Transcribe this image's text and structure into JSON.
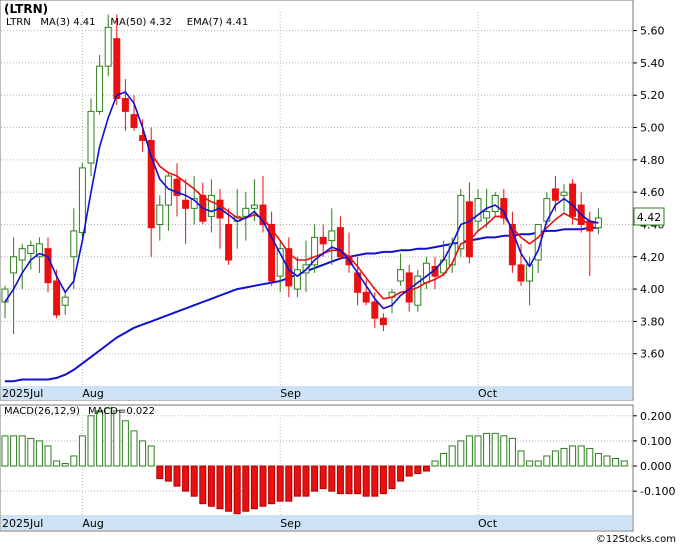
{
  "header": {
    "symbol": "(LTRN)",
    "legend": [
      {
        "name": "LTRN",
        "color": "#1f3bd6"
      },
      {
        "name": "MA(3)",
        "value": "4.41",
        "color": "#1f3bd6"
      },
      {
        "name": "MA(50)",
        "value": "4.32",
        "color": "#1f3bd6"
      },
      {
        "name": "EMA(7)",
        "value": "4.41",
        "color": "#1f3bd6"
      }
    ]
  },
  "last_price_label": "4.42",
  "macd": {
    "label": "MACD(26,12,9)",
    "value_label": "MACD=0.022"
  },
  "footer": {
    "brand": "©12Stocks.com"
  },
  "colors": {
    "up": "#2e7d1f",
    "down": "#e81010",
    "ma_blue": "#1010d0",
    "ema_red": "#e81010",
    "axis_band": "#cde3f5",
    "grid": "#b8b8b8"
  },
  "chart_data": [
    {
      "type": "candlestick",
      "title": "(LTRN)",
      "x_tick_labels": [
        "2025Jul",
        "Aug",
        "Sep",
        "Oct"
      ],
      "x_tick_index": [
        0,
        9,
        32,
        55
      ],
      "y_ticks": [
        3.6,
        3.8,
        4.0,
        4.2,
        4.4,
        4.6,
        4.8,
        5.0,
        5.2,
        5.4,
        5.6
      ],
      "ylim": [
        3.4,
        5.74
      ],
      "last_price": 4.42,
      "grid": true,
      "ohlc": [
        [
          3.92,
          4.02,
          3.82,
          4.0
        ],
        [
          4.1,
          4.32,
          3.72,
          4.2
        ],
        [
          4.18,
          4.28,
          4.0,
          4.25
        ],
        [
          4.22,
          4.3,
          4.12,
          4.27
        ],
        [
          4.2,
          4.32,
          4.1,
          4.28
        ],
        [
          4.25,
          4.32,
          3.98,
          4.04
        ],
        [
          4.05,
          4.12,
          3.82,
          3.84
        ],
        [
          3.9,
          3.98,
          3.84,
          3.95
        ],
        [
          4.2,
          4.5,
          4.0,
          4.36
        ],
        [
          4.35,
          4.78,
          4.32,
          4.75
        ],
        [
          4.78,
          5.18,
          4.7,
          5.1
        ],
        [
          5.1,
          5.45,
          5.08,
          5.38
        ],
        [
          5.38,
          5.7,
          5.32,
          5.62
        ],
        [
          5.55,
          5.7,
          5.14,
          5.18
        ],
        [
          5.18,
          5.3,
          4.98,
          5.1
        ],
        [
          5.08,
          5.2,
          4.98,
          5.0
        ],
        [
          4.95,
          5.05,
          4.85,
          4.92
        ],
        [
          4.92,
          5.0,
          4.2,
          4.38
        ],
        [
          4.4,
          4.58,
          4.3,
          4.52
        ],
        [
          4.52,
          4.72,
          4.36,
          4.7
        ],
        [
          4.68,
          4.78,
          4.45,
          4.58
        ],
        [
          4.55,
          4.68,
          4.28,
          4.5
        ],
        [
          4.5,
          4.7,
          4.4,
          4.56
        ],
        [
          4.58,
          4.66,
          4.4,
          4.42
        ],
        [
          4.45,
          4.68,
          4.35,
          4.58
        ],
        [
          4.55,
          4.62,
          4.25,
          4.44
        ],
        [
          4.4,
          4.5,
          4.15,
          4.18
        ],
        [
          4.42,
          4.62,
          4.25,
          4.45
        ],
        [
          4.45,
          4.6,
          4.3,
          4.5
        ],
        [
          4.5,
          4.68,
          4.42,
          4.52
        ],
        [
          4.52,
          4.7,
          4.35,
          4.4
        ],
        [
          4.4,
          4.48,
          4.02,
          4.05
        ],
        [
          4.08,
          4.3,
          3.98,
          4.25
        ],
        [
          4.25,
          4.32,
          3.95,
          4.02
        ],
        [
          4.0,
          4.2,
          3.95,
          4.12
        ],
        [
          4.1,
          4.3,
          3.98,
          4.15
        ],
        [
          4.15,
          4.4,
          4.1,
          4.32
        ],
        [
          4.32,
          4.4,
          4.2,
          4.28
        ],
        [
          4.3,
          4.5,
          4.15,
          4.36
        ],
        [
          4.38,
          4.45,
          4.18,
          4.2
        ],
        [
          4.2,
          4.35,
          4.1,
          4.15
        ],
        [
          4.1,
          4.2,
          3.9,
          3.98
        ],
        [
          3.98,
          4.06,
          3.9,
          3.92
        ],
        [
          3.92,
          3.98,
          3.76,
          3.82
        ],
        [
          3.82,
          3.85,
          3.74,
          3.78
        ],
        [
          3.95,
          4.0,
          3.85,
          3.98
        ],
        [
          4.05,
          4.22,
          4.02,
          4.12
        ],
        [
          4.1,
          4.15,
          3.86,
          3.92
        ],
        [
          3.9,
          4.12,
          3.86,
          4.08
        ],
        [
          4.04,
          4.2,
          4.0,
          4.16
        ],
        [
          4.14,
          4.2,
          4.0,
          4.08
        ],
        [
          4.1,
          4.3,
          4.08,
          4.18
        ],
        [
          4.15,
          4.32,
          4.1,
          4.28
        ],
        [
          4.25,
          4.62,
          4.2,
          4.58
        ],
        [
          4.54,
          4.66,
          4.16,
          4.2
        ],
        [
          4.42,
          4.62,
          4.35,
          4.56
        ],
        [
          4.44,
          4.62,
          4.38,
          4.48
        ],
        [
          4.48,
          4.6,
          4.45,
          4.58
        ],
        [
          4.56,
          4.62,
          4.4,
          4.44
        ],
        [
          4.4,
          4.48,
          4.1,
          4.15
        ],
        [
          4.15,
          4.28,
          4.02,
          4.05
        ],
        [
          4.05,
          4.2,
          3.9,
          4.15
        ],
        [
          4.18,
          4.4,
          4.1,
          4.4
        ],
        [
          4.42,
          4.6,
          4.4,
          4.56
        ],
        [
          4.62,
          4.7,
          4.48,
          4.55
        ],
        [
          4.58,
          4.65,
          4.48,
          4.6
        ],
        [
          4.65,
          4.68,
          4.4,
          4.45
        ],
        [
          4.52,
          4.6,
          4.35,
          4.4
        ],
        [
          4.42,
          4.48,
          4.08,
          4.36
        ],
        [
          4.38,
          4.5,
          4.34,
          4.44
        ]
      ],
      "series": [
        {
          "name": "MA(3)",
          "color": "#1010d0",
          "values": [
            3.92,
            4.0,
            4.1,
            4.18,
            4.22,
            4.2,
            4.08,
            3.98,
            4.05,
            4.3,
            4.6,
            4.88,
            5.06,
            5.2,
            5.22,
            5.15,
            5.0,
            4.82,
            4.68,
            4.62,
            4.6,
            4.58,
            4.55,
            4.5,
            4.48,
            4.5,
            4.46,
            4.42,
            4.44,
            4.48,
            4.42,
            4.32,
            4.22,
            4.12,
            4.08,
            4.12,
            4.18,
            4.22,
            4.26,
            4.24,
            4.18,
            4.1,
            4.02,
            3.94,
            3.88,
            3.9,
            3.96,
            4.0,
            4.04,
            4.08,
            4.12,
            4.18,
            4.28,
            4.4,
            4.42,
            4.46,
            4.5,
            4.52,
            4.48,
            4.36,
            4.22,
            4.14,
            4.24,
            4.42,
            4.52,
            4.56,
            4.52,
            4.46,
            4.42,
            4.41
          ]
        },
        {
          "name": "MA(50)",
          "color": "#1010d0",
          "values": [
            3.43,
            3.43,
            3.44,
            3.44,
            3.44,
            3.44,
            3.45,
            3.47,
            3.5,
            3.54,
            3.58,
            3.62,
            3.66,
            3.7,
            3.73,
            3.76,
            3.78,
            3.8,
            3.82,
            3.84,
            3.86,
            3.88,
            3.9,
            3.92,
            3.94,
            3.96,
            3.98,
            4.0,
            4.01,
            4.02,
            4.03,
            4.04,
            4.05,
            4.07,
            4.09,
            4.11,
            4.13,
            4.15,
            4.17,
            4.19,
            4.2,
            4.21,
            4.22,
            4.22,
            4.23,
            4.23,
            4.24,
            4.24,
            4.25,
            4.25,
            4.26,
            4.27,
            4.28,
            4.29,
            4.3,
            4.31,
            4.32,
            4.32,
            4.33,
            4.33,
            4.34,
            4.34,
            4.35,
            4.36,
            4.36,
            4.37,
            4.37,
            4.37,
            4.38,
            4.38
          ]
        },
        {
          "name": "EMA(7)",
          "color": "#e81010",
          "values": [
            null,
            null,
            null,
            null,
            null,
            null,
            null,
            null,
            null,
            null,
            null,
            null,
            null,
            null,
            null,
            null,
            4.98,
            4.84,
            4.76,
            4.72,
            4.7,
            4.66,
            4.62,
            4.57,
            4.54,
            4.52,
            4.48,
            4.44,
            4.44,
            4.46,
            4.44,
            4.37,
            4.3,
            4.22,
            4.18,
            4.18,
            4.2,
            4.22,
            4.24,
            4.24,
            4.2,
            4.14,
            4.07,
            4.0,
            3.94,
            3.95,
            3.98,
            3.99,
            4.01,
            4.04,
            4.06,
            4.09,
            4.16,
            4.28,
            4.3,
            4.36,
            4.4,
            4.45,
            4.45,
            4.38,
            4.32,
            4.28,
            4.32,
            4.38,
            4.43,
            4.47,
            4.44,
            4.42,
            4.41,
            4.41
          ]
        }
      ]
    },
    {
      "type": "bar",
      "title": "MACD(26,12,9)",
      "y_ticks": [
        -0.1,
        0.0,
        0.1,
        0.2
      ],
      "ylim": [
        -0.195,
        0.235
      ],
      "grid": true,
      "values": [
        0.12,
        0.12,
        0.12,
        0.11,
        0.1,
        0.08,
        0.02,
        0.01,
        0.04,
        0.12,
        0.2,
        0.22,
        0.23,
        0.22,
        0.18,
        0.14,
        0.1,
        0.08,
        -0.05,
        -0.06,
        -0.08,
        -0.1,
        -0.12,
        -0.15,
        -0.16,
        -0.17,
        -0.18,
        -0.19,
        -0.18,
        -0.17,
        -0.16,
        -0.15,
        -0.14,
        -0.14,
        -0.12,
        -0.12,
        -0.1,
        -0.09,
        -0.1,
        -0.11,
        -0.11,
        -0.11,
        -0.12,
        -0.12,
        -0.11,
        -0.09,
        -0.06,
        -0.04,
        -0.03,
        -0.02,
        0.02,
        0.05,
        0.08,
        0.1,
        0.12,
        0.12,
        0.13,
        0.13,
        0.12,
        0.11,
        0.06,
        0.02,
        0.02,
        0.04,
        0.06,
        0.07,
        0.08,
        0.08,
        0.07,
        0.05,
        0.04,
        0.03,
        0.02
      ]
    }
  ]
}
